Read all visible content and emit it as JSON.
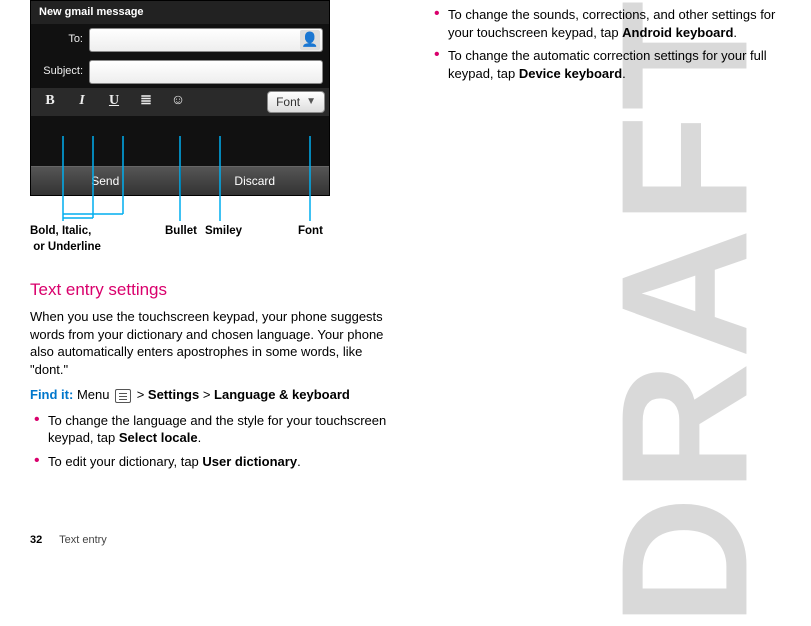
{
  "watermark": "DRAFT",
  "phone": {
    "title": "New gmail message",
    "to_label": "To:",
    "subject_label": "Subject:",
    "font_button": "Font",
    "send": "Send",
    "discard": "Discard",
    "toolbar": {
      "bold": "B",
      "italic": "I",
      "underline": "U",
      "bullet": "≣",
      "smiley": "☺"
    }
  },
  "callouts": {
    "biu": "Bold, Italic,\n or Underline",
    "bullet": "Bullet",
    "smiley": "Smiley",
    "font": "Font"
  },
  "left": {
    "section_title": "Text entry settings",
    "para1": "When you use the touchscreen keypad, your phone suggests words from your dictionary and chosen language. Your phone also automatically enters apostrophes in some words, like \"dont.\"",
    "findit_label": "Find it:",
    "findit_text_1": " Menu ",
    "findit_gt1": " > ",
    "findit_b1": "Settings",
    "findit_gt2": " > ",
    "findit_b2": "Language & keyboard",
    "bullet1_a": "To change the language and the style for your touchscreen keypad, tap ",
    "bullet1_b": "Select locale",
    "bullet1_c": ".",
    "bullet2_a": "To edit your dictionary, tap ",
    "bullet2_b": "User dictionary",
    "bullet2_c": "."
  },
  "right": {
    "bullet1_a": "To change the sounds, corrections, and other settings for your touchscreen keypad, tap ",
    "bullet1_b": "Android keyboard",
    "bullet1_c": ".",
    "bullet2_a": "To change the automatic correction settings for your full keypad, tap ",
    "bullet2_b": "Device keyboard",
    "bullet2_c": "."
  },
  "footer": {
    "page": "32",
    "section": "Text entry"
  }
}
